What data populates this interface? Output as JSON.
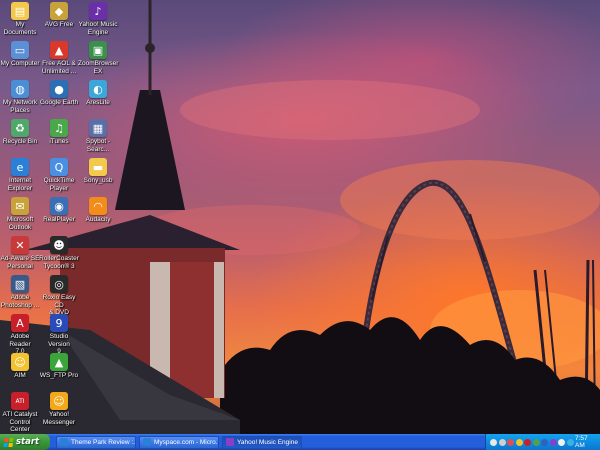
{
  "desktop": {
    "icons": [
      {
        "label": "My Documents",
        "icon": "folder-documents-icon",
        "color": "#f2c94c",
        "glyph": "▤"
      },
      {
        "label": "AVG Free",
        "icon": "avg-shield-icon",
        "color": "#c8a23a",
        "glyph": "◆"
      },
      {
        "label": "Yahoo! Music\nEngine",
        "icon": "yahoo-music-icon",
        "color": "#6b2fa8",
        "glyph": "♪"
      },
      {
        "label": "My Computer",
        "icon": "computer-icon",
        "color": "#5b8fd6",
        "glyph": "▭"
      },
      {
        "label": "Free AOL &\nUnlimited ...",
        "icon": "aol-icon",
        "color": "#d9392b",
        "glyph": "▲"
      },
      {
        "label": "ZoomBrowser\nEX",
        "icon": "zoombrowser-icon",
        "color": "#3a8f4a",
        "glyph": "▣"
      },
      {
        "label": "My Network\nPlaces",
        "icon": "network-places-icon",
        "color": "#4a8fd6",
        "glyph": "◍"
      },
      {
        "label": "Google Earth",
        "icon": "google-earth-icon",
        "color": "#2d6fb5",
        "glyph": "●"
      },
      {
        "label": "AresLite",
        "icon": "areslite-icon",
        "color": "#3aa6d9",
        "glyph": "◐"
      },
      {
        "label": "Recycle Bin",
        "icon": "recycle-bin-icon",
        "color": "#4fa86a",
        "glyph": "♻"
      },
      {
        "label": "iTunes",
        "icon": "itunes-icon",
        "color": "#4aa84a",
        "glyph": "♫"
      },
      {
        "label": "Spybot -\nSearc...",
        "icon": "spybot-icon",
        "color": "#5a6fa8",
        "glyph": "▦"
      },
      {
        "label": "Internet\nExplorer",
        "icon": "internet-explorer-icon",
        "color": "#2a7fd6",
        "glyph": "e"
      },
      {
        "label": "QuickTime\nPlayer",
        "icon": "quicktime-icon",
        "color": "#4a90e2",
        "glyph": "Q"
      },
      {
        "label": "Sony_usb",
        "icon": "folder-icon",
        "color": "#f2c94c",
        "glyph": "▬"
      },
      {
        "label": "Microsoft\nOutlook",
        "icon": "outlook-icon",
        "color": "#c8a23a",
        "glyph": "✉"
      },
      {
        "label": "RealPlayer",
        "icon": "realplayer-icon",
        "color": "#3a6fb5",
        "glyph": "◉"
      },
      {
        "label": "Audacity",
        "icon": "audacity-icon",
        "color": "#f28c1a",
        "glyph": "◠"
      },
      {
        "label": "Ad-Aware SE\nPersonal",
        "icon": "adaware-icon",
        "color": "#c83a3a",
        "glyph": "✕"
      },
      {
        "label": "RollerCoaster\nTycoon® 3",
        "icon": "rollercoaster-tycoon-icon",
        "color": "#2a2a2a",
        "glyph": "☻"
      },
      {
        "label": "Adobe\nPhotoshop ...",
        "icon": "photoshop-icon",
        "color": "#3a5a8a",
        "glyph": "▧"
      },
      {
        "label": "Roxio Easy CD\n& DVD Crea...",
        "icon": "roxio-icon",
        "color": "#2a2a2a",
        "glyph": "◎"
      },
      {
        "label": "Adobe Reader\n7.0",
        "icon": "adobe-reader-icon",
        "color": "#c8202a",
        "glyph": "A"
      },
      {
        "label": "Studio Version\n9",
        "icon": "studio-icon",
        "color": "#2a4ab5",
        "glyph": "9"
      },
      {
        "label": "AIM",
        "icon": "aim-icon",
        "color": "#f2c230",
        "glyph": "☺"
      },
      {
        "label": "WS_FTP Pro",
        "icon": "ws-ftp-icon",
        "color": "#3aa63a",
        "glyph": "▲"
      },
      {
        "label": "ATI Catalyst\nControl Center",
        "icon": "ati-catalyst-icon",
        "color": "#c8202a",
        "glyph": "ATI"
      },
      {
        "label": "Yahoo!\nMessenger",
        "icon": "yahoo-messenger-icon",
        "color": "#f2a81a",
        "glyph": "☺"
      }
    ]
  },
  "taskbar": {
    "start_label": "start",
    "tasks": [
      {
        "label": "Theme Park Review :...",
        "icon_color": "#2a7fd6",
        "active": false
      },
      {
        "label": "Myspace.com - Micro...",
        "icon_color": "#2a7fd6",
        "active": false
      },
      {
        "label": "Yahoo! Music Engine",
        "icon_color": "#8a3fc8",
        "active": true
      }
    ],
    "tray_icons": [
      {
        "name": "network-tray-icon",
        "color": "#e8e8e8"
      },
      {
        "name": "volume-tray-icon",
        "color": "#d0d0d0"
      },
      {
        "name": "shield-tray-icon",
        "color": "#e05050"
      },
      {
        "name": "messenger-tray-icon",
        "color": "#f2c230"
      },
      {
        "name": "ati-tray-icon",
        "color": "#c8202a"
      },
      {
        "name": "update-tray-icon",
        "color": "#50a050"
      },
      {
        "name": "antivirus-tray-icon",
        "color": "#3060c0"
      },
      {
        "name": "music-tray-icon",
        "color": "#8a3fc8"
      },
      {
        "name": "security-tray-icon",
        "color": "#f2f2f2"
      },
      {
        "name": "display-tray-icon",
        "color": "#40b0e0"
      }
    ],
    "clock": "7:57 AM"
  }
}
